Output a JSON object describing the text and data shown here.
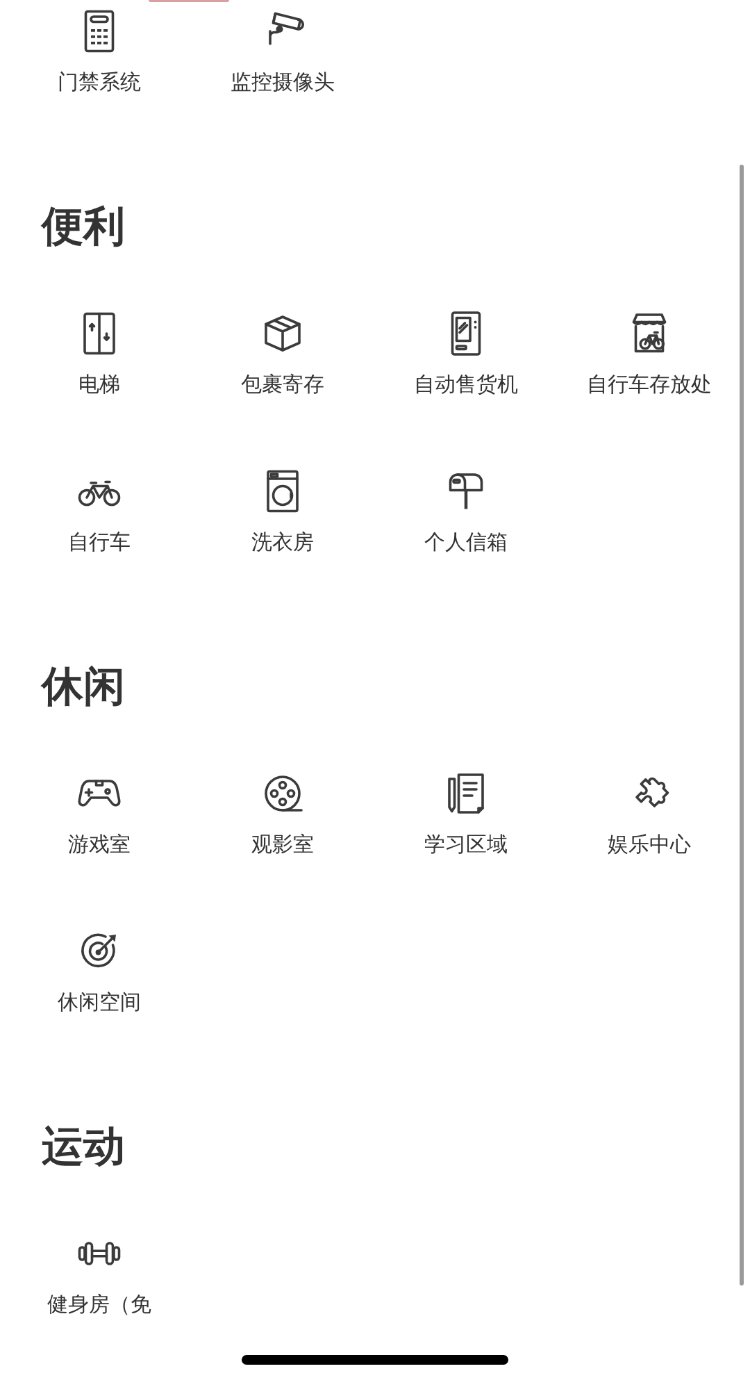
{
  "top_items": [
    {
      "label": "门禁系统",
      "kind": "keypad"
    },
    {
      "label": "监控摄像头",
      "kind": "camera"
    }
  ],
  "sections": [
    {
      "title": "便利",
      "items": [
        {
          "label": "电梯",
          "kind": "elevator"
        },
        {
          "label": "包裹寄存",
          "kind": "box"
        },
        {
          "label": "自动售货机",
          "kind": "vending"
        },
        {
          "label": "自行车存放处",
          "kind": "bikeshop"
        },
        {
          "label": "自行车",
          "kind": "bike"
        },
        {
          "label": "洗衣房",
          "kind": "washer"
        },
        {
          "label": "个人信箱",
          "kind": "mailbox"
        }
      ]
    },
    {
      "title": "休闲",
      "items": [
        {
          "label": "游戏室",
          "kind": "gamepad"
        },
        {
          "label": "观影室",
          "kind": "reel"
        },
        {
          "label": "学习区域",
          "kind": "notes"
        },
        {
          "label": "娱乐中心",
          "kind": "puzzle"
        },
        {
          "label": "休闲空间",
          "kind": "target"
        }
      ]
    },
    {
      "title": "运动",
      "items": [
        {
          "label": "健身房（免",
          "kind": "dumbbell"
        }
      ]
    }
  ]
}
